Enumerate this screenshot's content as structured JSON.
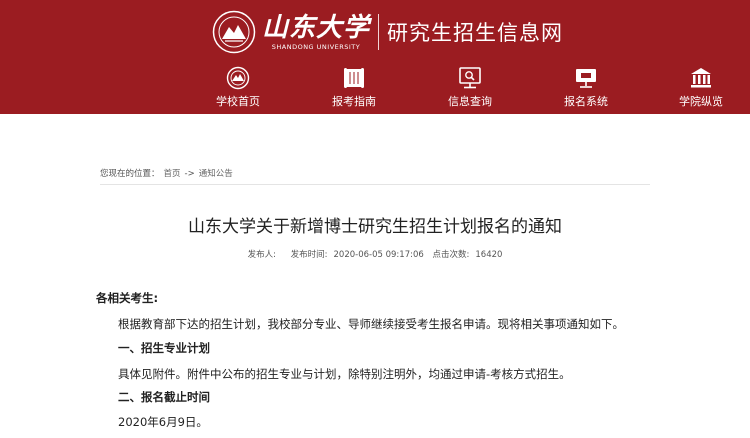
{
  "header": {
    "brand_cn": "山东大学",
    "brand_en": "SHANDONG UNIVERSITY",
    "site_name": "研究生招生信息网",
    "bg_color": "#9b1c21"
  },
  "nav": {
    "items": [
      {
        "label": "学校首页",
        "icon": "school-emblem-icon"
      },
      {
        "label": "报考指南",
        "icon": "scroll-book-icon"
      },
      {
        "label": "信息查询",
        "icon": "monitor-search-icon"
      },
      {
        "label": "报名系统",
        "icon": "registration-screen-icon"
      },
      {
        "label": "学院纵览",
        "icon": "building-icon"
      }
    ]
  },
  "breadcrumb": {
    "prefix": "您现在的位置：",
    "home": "首页",
    "separator": "->",
    "current": "通知公告"
  },
  "article": {
    "title": "山东大学关于新增博士研究生招生计划报名的通知",
    "meta": {
      "author_label": "发布人:",
      "author": "",
      "time_label": "发布时间:",
      "time": "2020-06-05 09:17:06",
      "hits_label": "点击次数:",
      "hits": "16420"
    },
    "greeting": "各相关考生:",
    "para1": "根据教育部下达的招生计划，我校部分专业、导师继续接受考生报名申请。现将相关事项通知如下。",
    "section1": "一、招生专业计划",
    "para2": "具体见附件。附件中公布的招生专业与计划，除特别注明外，均通过申请-考核方式招生。",
    "section2": "二、报名截止时间",
    "para3": "2020年6月9日。"
  }
}
